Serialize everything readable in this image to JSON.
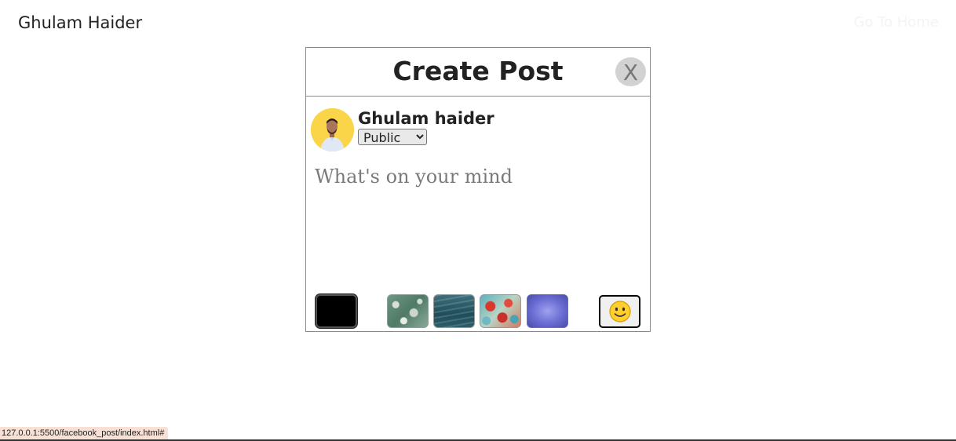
{
  "header": {
    "site_title": "Ghulam Haider",
    "go_home_label": "Go To Home"
  },
  "modal": {
    "title": "Create Post",
    "close_label": "X",
    "author_name": "Ghulam haider",
    "privacy_selected": "Public",
    "post_placeholder": "What's on your mind",
    "backgrounds": [
      {
        "name": "black",
        "color": "#000000"
      },
      {
        "name": "moss-texture"
      },
      {
        "name": "water-texture"
      },
      {
        "name": "paint-texture"
      },
      {
        "name": "violet-gradient",
        "color": "#6a6cd3"
      }
    ],
    "emoji_icon": "smiley-face-icon"
  },
  "status_bar": {
    "url": "127.0.0.1:5500/facebook_post/index.html#"
  },
  "colors": {
    "avatar_bg": "#fad54a",
    "close_bg": "#d2d2d2",
    "status_bg": "#f8e0d4"
  }
}
